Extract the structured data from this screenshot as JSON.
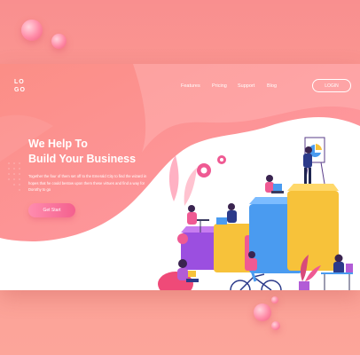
{
  "nav": {
    "logo_line1": "LO",
    "logo_line2": "GO",
    "links": [
      "Features",
      "Pricing",
      "Support",
      "Blog"
    ],
    "login_label": "LOGIN"
  },
  "hero": {
    "title_line1": "We Help To",
    "title_line2": "Build Your Business",
    "body": "Together the four of them set off to the Emerald City to find the wizard in hopes that he could bestow upon them these virtues and find a way for Dorothy to go",
    "cta_label": "Get Start"
  },
  "colors": {
    "background": "#f98f8f",
    "accent": "#f4608e",
    "card": "#ffffff",
    "block_purple": "#b25cd6",
    "block_blue": "#4a9bf0",
    "block_yellow": "#f7c23a"
  }
}
